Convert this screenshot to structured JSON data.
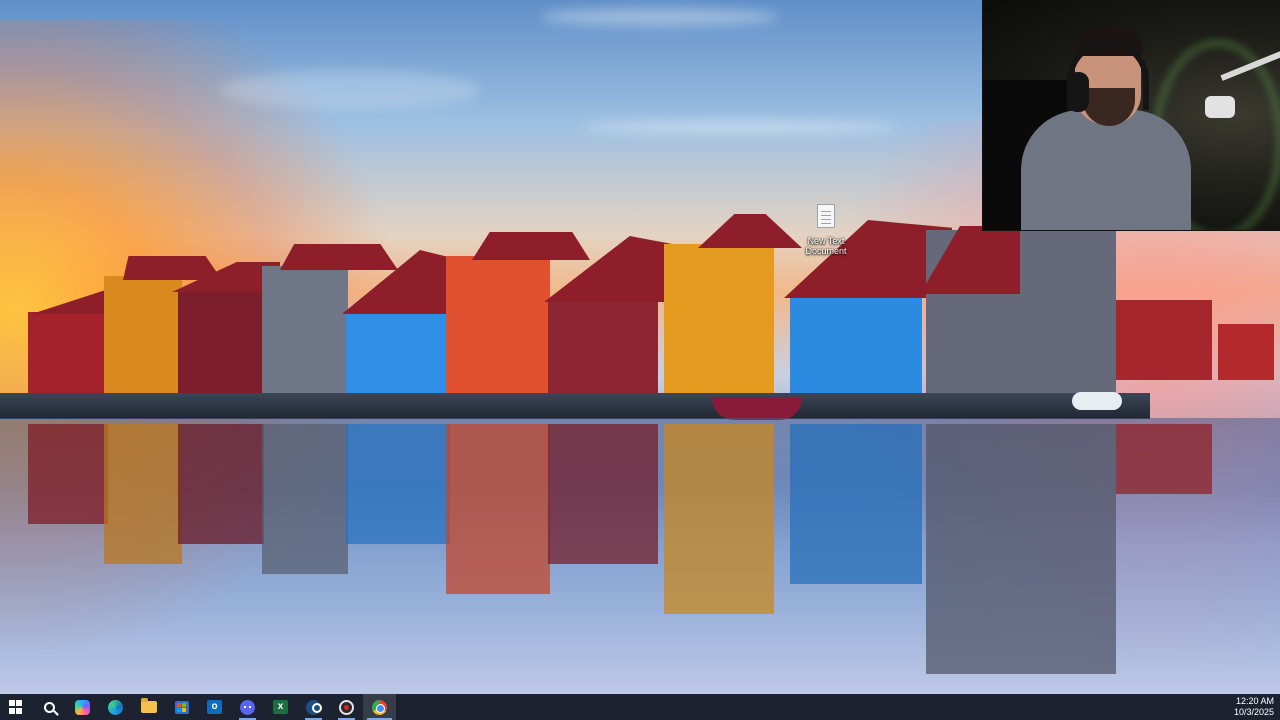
{
  "desktop": {
    "icons": [
      {
        "label": "New Text Document",
        "icon": "text-file-icon"
      }
    ]
  },
  "webcam": {
    "icon": "webcam-feed"
  },
  "taskbar": {
    "start_icon": "windows-start-icon",
    "apps": [
      {
        "name": "Search",
        "icon": "search-icon"
      },
      {
        "name": "Copilot",
        "icon": "copilot-icon"
      },
      {
        "name": "Microsoft Edge",
        "icon": "edge-icon"
      },
      {
        "name": "File Explorer",
        "icon": "folder-icon"
      },
      {
        "name": "Microsoft Store",
        "icon": "store-icon"
      },
      {
        "name": "Outlook",
        "icon": "outlook-icon"
      },
      {
        "name": "Discord",
        "icon": "discord-icon"
      },
      {
        "name": "Excel",
        "icon": "excel-icon"
      },
      {
        "name": "Steam",
        "icon": "steam-icon"
      },
      {
        "name": "OBS Studio",
        "icon": "obs-icon"
      },
      {
        "name": "Google Chrome",
        "icon": "chrome-icon"
      }
    ],
    "clock": {
      "time": "12:20 AM",
      "date": "10/3/2025"
    }
  },
  "colors": {
    "taskbar_bg": "#1c2230",
    "active_indicator": "#7aa7e6"
  }
}
